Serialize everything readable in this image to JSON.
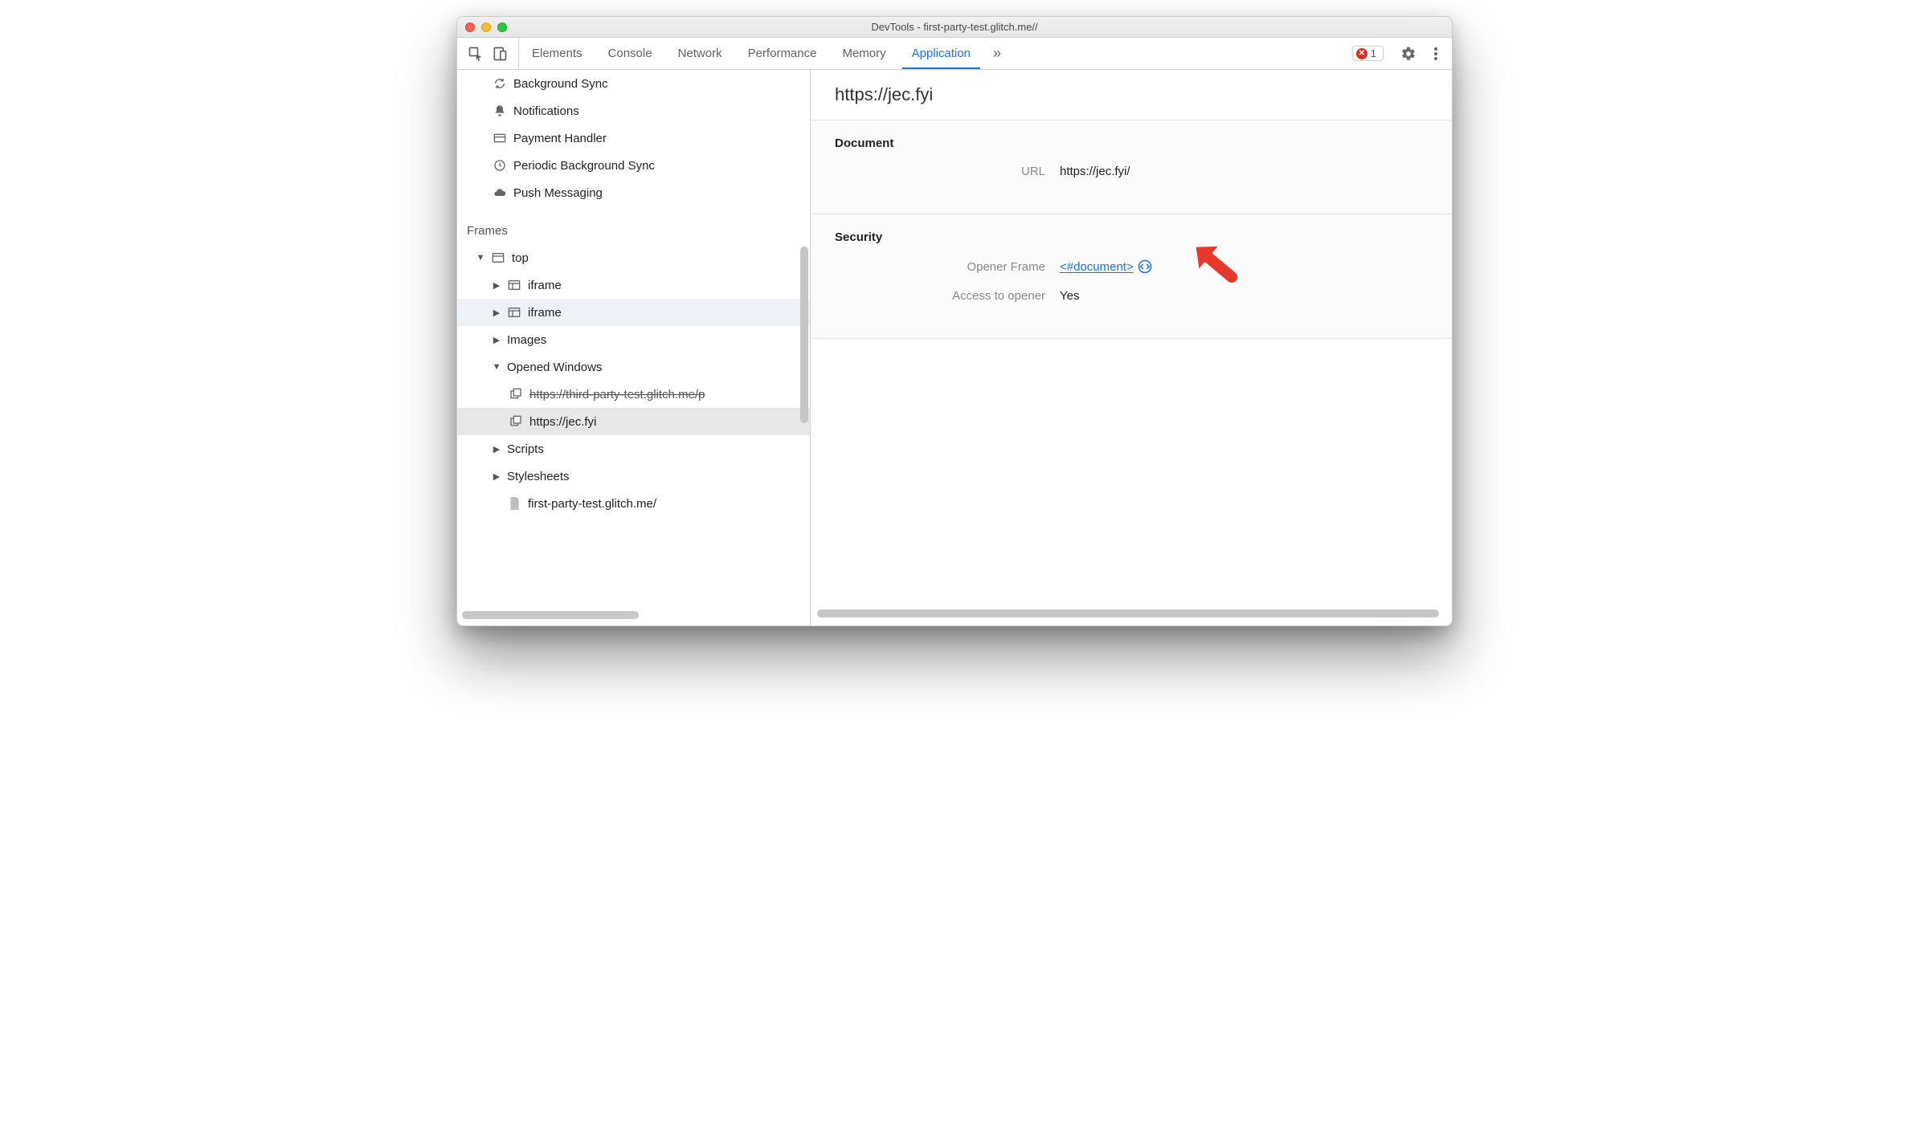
{
  "window": {
    "title": "DevTools - first-party-test.glitch.me//"
  },
  "toolbar": {
    "tabs": {
      "elements": "Elements",
      "console": "Console",
      "network": "Network",
      "performance": "Performance",
      "memory": "Memory",
      "application": "Application"
    },
    "more_tabs": "»",
    "error_count": "1"
  },
  "sidebar": {
    "bg_items": {
      "background_sync": "Background Sync",
      "notifications": "Notifications",
      "payment_handler": "Payment Handler",
      "periodic_bg_sync": "Periodic Background Sync",
      "push_messaging": "Push Messaging"
    },
    "frames_label": "Frames",
    "tree": {
      "top": "top",
      "iframe1": "iframe",
      "iframe2": "iframe",
      "images": "Images",
      "opened_windows": "Opened Windows",
      "opened_win_1": "https://third-party-test.glitch.me/p",
      "opened_win_2": "https://jec.fyi",
      "scripts": "Scripts",
      "stylesheets": "Stylesheets",
      "origin_doc": "first-party-test.glitch.me/"
    }
  },
  "detail": {
    "title": "https://jec.fyi",
    "sections": {
      "document": {
        "heading": "Document",
        "url_label": "URL",
        "url_value": "https://jec.fyi/"
      },
      "security": {
        "heading": "Security",
        "opener_frame_label": "Opener Frame",
        "opener_frame_value": "<#document>",
        "access_label": "Access to opener",
        "access_value": "Yes"
      }
    }
  }
}
